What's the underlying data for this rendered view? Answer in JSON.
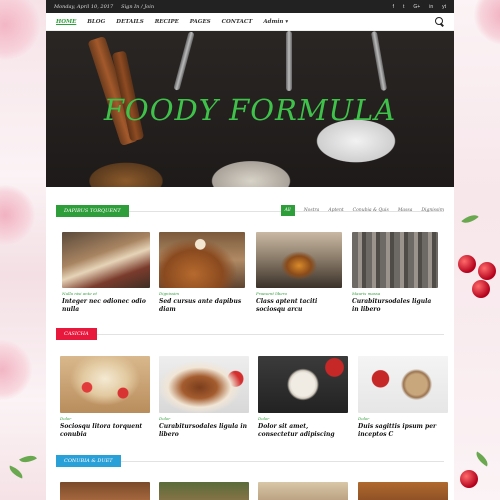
{
  "topbar": {
    "date": "Monday, April 10, 2017",
    "signin": "Sign In / Join",
    "social": [
      "f",
      "t",
      "G+",
      "in",
      "yt"
    ]
  },
  "nav": {
    "items": [
      "HOME",
      "BLOG",
      "DETAILS",
      "RECIPE",
      "PAGES",
      "CONTACT",
      "Admin ▾"
    ]
  },
  "hero": {
    "title": "FOODY FORMULA"
  },
  "section1": {
    "tag": "DAPIBUS TORQUENT",
    "filters": [
      "All",
      "Nostra",
      "Aptent",
      "Conubia & Quis",
      "Massa",
      "Dignissim"
    ],
    "cards": [
      {
        "category": "Nulla nisi ante et",
        "title": "Integer nec odionec odio nulla"
      },
      {
        "category": "Dignissim",
        "title": "Sed cursus ante dapibus diam"
      },
      {
        "category": "Praesent libero",
        "title": "Class aptent taciti sociosqu arcu"
      },
      {
        "category": "Mauris massa",
        "title": "Curabitursodales ligula in libero"
      }
    ]
  },
  "section2": {
    "tag": "CASICHA",
    "cards": [
      {
        "category": "Dolor",
        "title": "Sociosqu litora torquent conubia"
      },
      {
        "category": "Dolor",
        "title": "Curabitursodales ligula in libero"
      },
      {
        "category": "Dolor",
        "title": "Dolor sit amet, consectetur adipiscing"
      },
      {
        "category": "Dolor",
        "title": "Duis sagittis ipsum per inceptos C"
      }
    ]
  },
  "section3": {
    "tag": "CONUBIA & DUET"
  },
  "colors": {
    "accent_green": "#2e9e3a",
    "accent_red": "#e8183c",
    "accent_blue": "#2aa0d8",
    "hero_title": "#3fc24a"
  }
}
